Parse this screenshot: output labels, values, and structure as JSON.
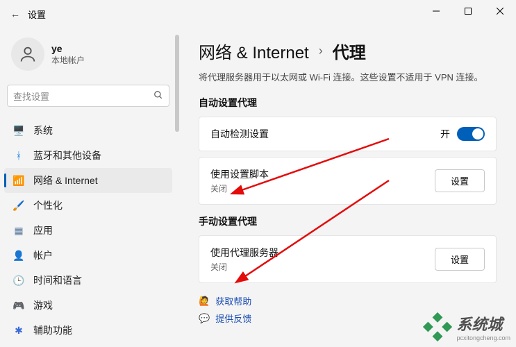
{
  "window": {
    "title": "设置"
  },
  "user": {
    "name": "ye",
    "type": "本地帐户"
  },
  "search": {
    "placeholder": "查找设置"
  },
  "nav": {
    "items": [
      {
        "label": "系统",
        "icon": "🖥️",
        "color": "#0d5ecd"
      },
      {
        "label": "蓝牙和其他设备",
        "icon": "ᚼ",
        "color": "#0d7ae0"
      },
      {
        "label": "网络 & Internet",
        "icon": "📶",
        "color": "#0d7ae0"
      },
      {
        "label": "个性化",
        "icon": "🖌️",
        "color": "#c25e1a"
      },
      {
        "label": "应用",
        "icon": "▦",
        "color": "#5b7a9e"
      },
      {
        "label": "帐户",
        "icon": "👤",
        "color": "#4a6b8a"
      },
      {
        "label": "时间和语言",
        "icon": "🕒",
        "color": "#4a6b8a"
      },
      {
        "label": "游戏",
        "icon": "🎮",
        "color": "#3a7a5a"
      },
      {
        "label": "辅助功能",
        "icon": "✱",
        "color": "#3a6bd8"
      }
    ],
    "active_index": 2
  },
  "breadcrumb": {
    "parent": "网络 & Internet",
    "current": "代理"
  },
  "description": "将代理服务器用于以太网或 Wi-Fi 连接。这些设置不适用于 VPN 连接。",
  "sections": {
    "auto": {
      "heading": "自动设置代理",
      "detect": {
        "label": "自动检测设置",
        "state_label": "开",
        "on": true
      },
      "script": {
        "label": "使用设置脚本",
        "status": "关闭",
        "button": "设置"
      }
    },
    "manual": {
      "heading": "手动设置代理",
      "proxy": {
        "label": "使用代理服务器",
        "status": "关闭",
        "button": "设置"
      }
    }
  },
  "footer": {
    "help": "获取帮助",
    "feedback": "提供反馈"
  },
  "watermark": {
    "text": "系统城",
    "sub": "pcxitongcheng.com"
  }
}
